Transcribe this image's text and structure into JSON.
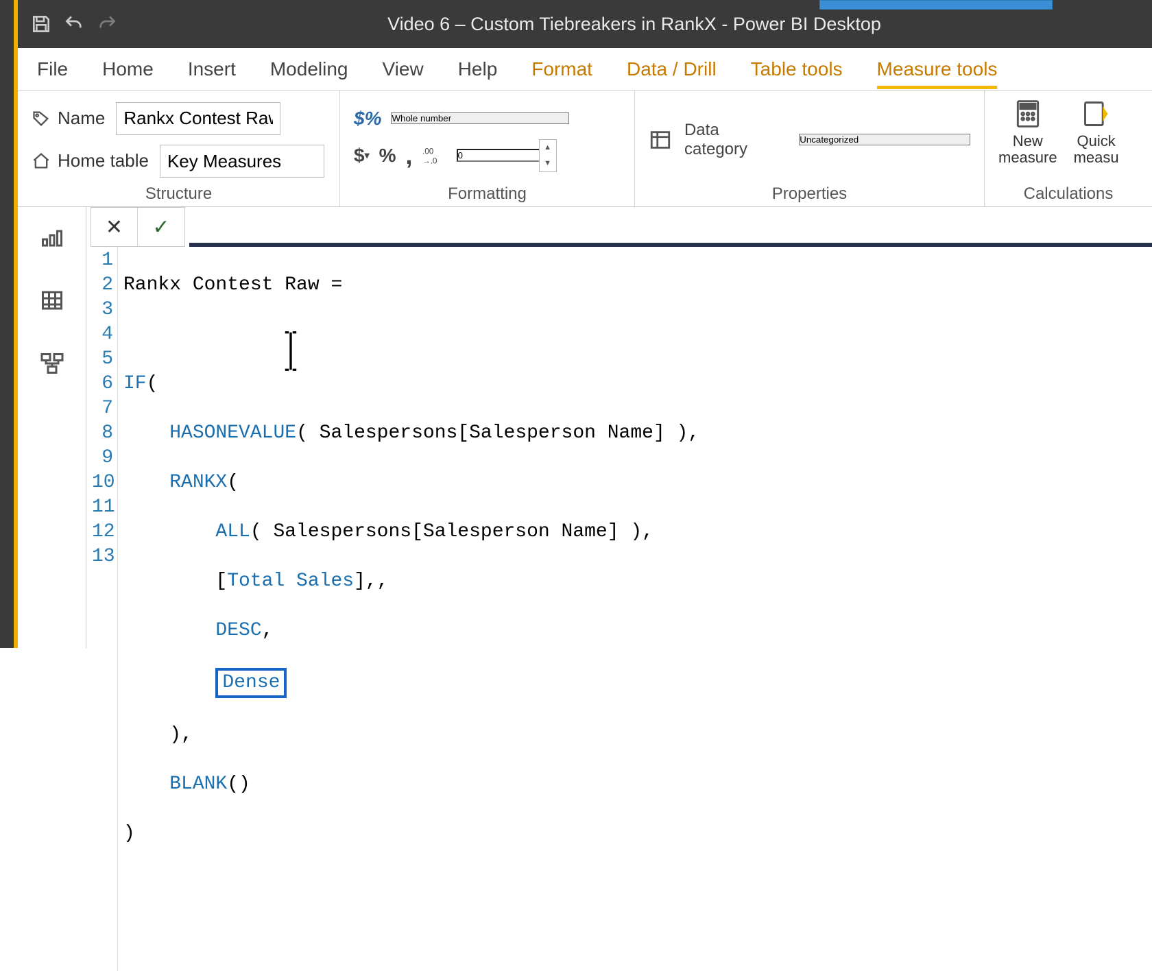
{
  "titlebar": {
    "title": "Video 6 – Custom Tiebreakers in RankX - Power BI Desktop"
  },
  "ribbon_tabs": {
    "file": "File",
    "home": "Home",
    "insert": "Insert",
    "modeling": "Modeling",
    "view": "View",
    "help": "Help",
    "format": "Format",
    "datadrill": "Data / Drill",
    "tabletools": "Table tools",
    "measuretools": "Measure tools"
  },
  "structure": {
    "name_label": "Name",
    "name_value": "Rankx Contest Raw",
    "home_table_label": "Home table",
    "home_table_value": "Key Measures",
    "group_label": "Structure"
  },
  "formatting": {
    "format_value": "Whole number",
    "decimals": "0",
    "group_label": "Formatting",
    "currency_symbol": "$",
    "percent_symbol": "%",
    "thousands_symbol": ",",
    "precision_symbol": ".00→.0",
    "format_prefix": "$%"
  },
  "properties": {
    "category_label": "Data category",
    "category_value": "Uncategorized",
    "group_label": "Properties"
  },
  "calculations": {
    "new_measure": "New\nmeasure",
    "quick_measure": "Quick\nmeasu",
    "group_label": "Calculations"
  },
  "formula_bar": {
    "cancel": "✕",
    "commit": "✓"
  },
  "code": {
    "l1": "Rankx Contest Raw =",
    "l2": "",
    "l3a": "IF",
    "l3b": "(",
    "l4a": "    ",
    "l4b": "HASONEVALUE",
    "l4c": "( Salespersons[Salesperson Name] ),",
    "l5a": "    ",
    "l5b": "RANKX",
    "l5c": "(",
    "l6a": "        ",
    "l6b": "ALL",
    "l6c": "( Salespersons[Salesperson Name] ),",
    "l7a": "        [",
    "l7b": "Total Sales",
    "l7c": "],,",
    "l8a": "        ",
    "l8b": "DESC",
    "l8c": ",",
    "l9a": "        ",
    "l9b": "Dense",
    "l10": "    ),",
    "l11a": "    ",
    "l11b": "BLANK",
    "l11c": "()",
    "l12": ")",
    "l13": ""
  },
  "line_numbers": [
    "1",
    "2",
    "3",
    "4",
    "5",
    "6",
    "7",
    "8",
    "9",
    "10",
    "11",
    "12",
    "13"
  ]
}
